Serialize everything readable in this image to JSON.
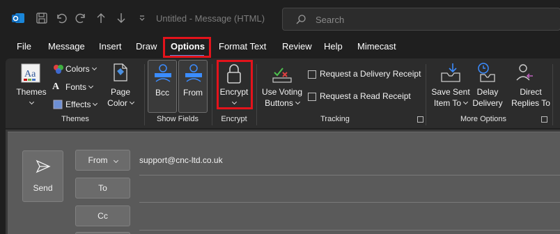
{
  "titlebar": {
    "doc_title": "Untitled  -  Message (HTML)",
    "search_placeholder": "Search"
  },
  "menu": {
    "items": [
      "File",
      "Message",
      "Insert",
      "Draw",
      "Options",
      "Format Text",
      "Review",
      "Help",
      "Mimecast"
    ],
    "active": "Options"
  },
  "ribbon": {
    "themes": {
      "themes_label": "Themes",
      "colors_label": "Colors",
      "fonts_label": "Fonts",
      "effects_label": "Effects",
      "page_color_line1": "Page",
      "page_color_line2": "Color",
      "group_label": "Themes"
    },
    "show_fields": {
      "bcc_label": "Bcc",
      "from_label": "From",
      "group_label": "Show Fields"
    },
    "encrypt": {
      "encrypt_label": "Encrypt",
      "group_label": "Encrypt"
    },
    "tracking": {
      "voting_line1": "Use Voting",
      "voting_line2": "Buttons",
      "delivery_receipt": "Request a Delivery Receipt",
      "read_receipt": "Request a Read Receipt",
      "group_label": "Tracking"
    },
    "more_options": {
      "save_sent_line1": "Save Sent",
      "save_sent_line2": "Item To",
      "delay_line1": "Delay",
      "delay_line2": "Delivery",
      "direct_line1": "Direct",
      "direct_line2": "Replies To",
      "group_label": "More Options"
    }
  },
  "compose": {
    "send_label": "Send",
    "from_label": "From",
    "from_value": "support@cnc-ltd.co.uk",
    "to_label": "To",
    "cc_label": "Cc"
  },
  "colors": {
    "highlight_red": "#e3131b",
    "accent_blue": "#5d8fe0",
    "outlook_blue": "#0f6cbd"
  }
}
